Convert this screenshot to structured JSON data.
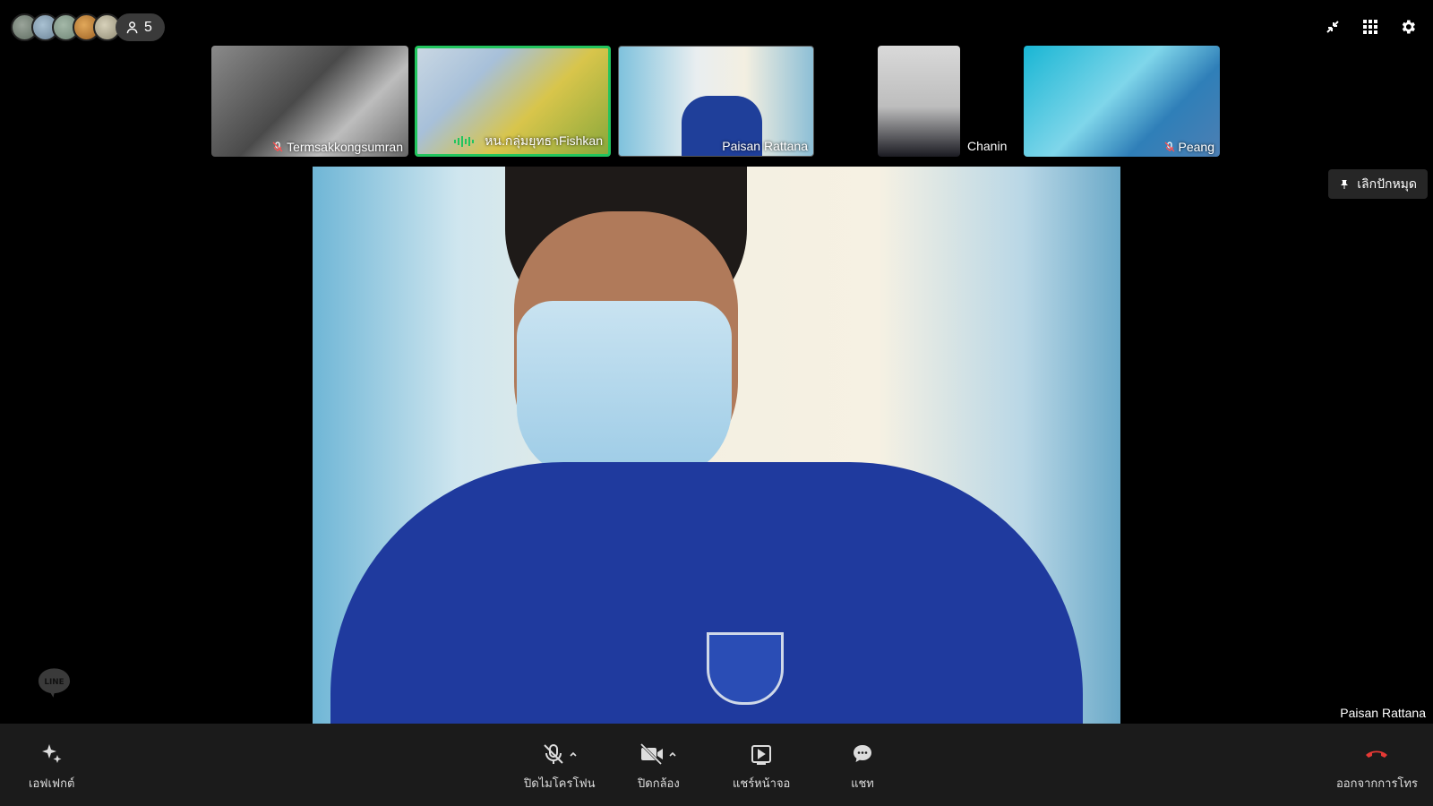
{
  "participants": {
    "count": "5",
    "avatar_colors": [
      "#7a8a7a",
      "#8fa7b8",
      "#8aa094",
      "#c2853e",
      "#b8b29a"
    ]
  },
  "top_icons": [
    "minimize-icon",
    "apps-grid-icon",
    "settings-gear-icon"
  ],
  "filmstrip": [
    {
      "name": "Termsakkongsumran",
      "muted": true
    },
    {
      "name": "หน.กลุ่มยุทธาFishkan",
      "speaking": true
    },
    {
      "name": "Paisan Rattana",
      "muted": false
    },
    {
      "name": "Chanin",
      "muted": false
    },
    {
      "name": "Peang",
      "muted": true
    }
  ],
  "main": {
    "speaker_name": "Paisan Rattana",
    "unpin_label": "เลิกปักหมุด"
  },
  "toolbar": {
    "effects_label": "เอฟเฟกต์",
    "mic_label": "ปิดไมโครโฟน",
    "camera_label": "ปิดกล้อง",
    "share_label": "แชร์หน้าจอ",
    "chat_label": "แชท",
    "leave_label": "ออกจากการโทร"
  },
  "colors": {
    "background": "#000000",
    "toolbar_bg": "#1b1b1b",
    "speaking_border": "#22c55e",
    "leave_red": "#e53935"
  }
}
